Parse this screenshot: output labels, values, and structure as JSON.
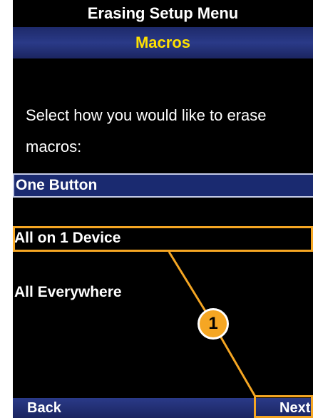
{
  "header": {
    "title": "Erasing Setup Menu",
    "subtitle": "Macros"
  },
  "prompt": "Select how you would like to erase macros:",
  "options": [
    {
      "label": "One Button",
      "selected": true
    },
    {
      "label": "All on 1 Device",
      "selected": false
    },
    {
      "label": "All Everywhere",
      "selected": false
    }
  ],
  "footer": {
    "back_label": "Back",
    "next_label": "Next"
  },
  "callout": {
    "number": "1",
    "color": "#f5a623"
  },
  "colors": {
    "background": "#000000",
    "header_bar": "#26337a",
    "subtitle_text": "#ffe100",
    "text": "#ffffff"
  }
}
